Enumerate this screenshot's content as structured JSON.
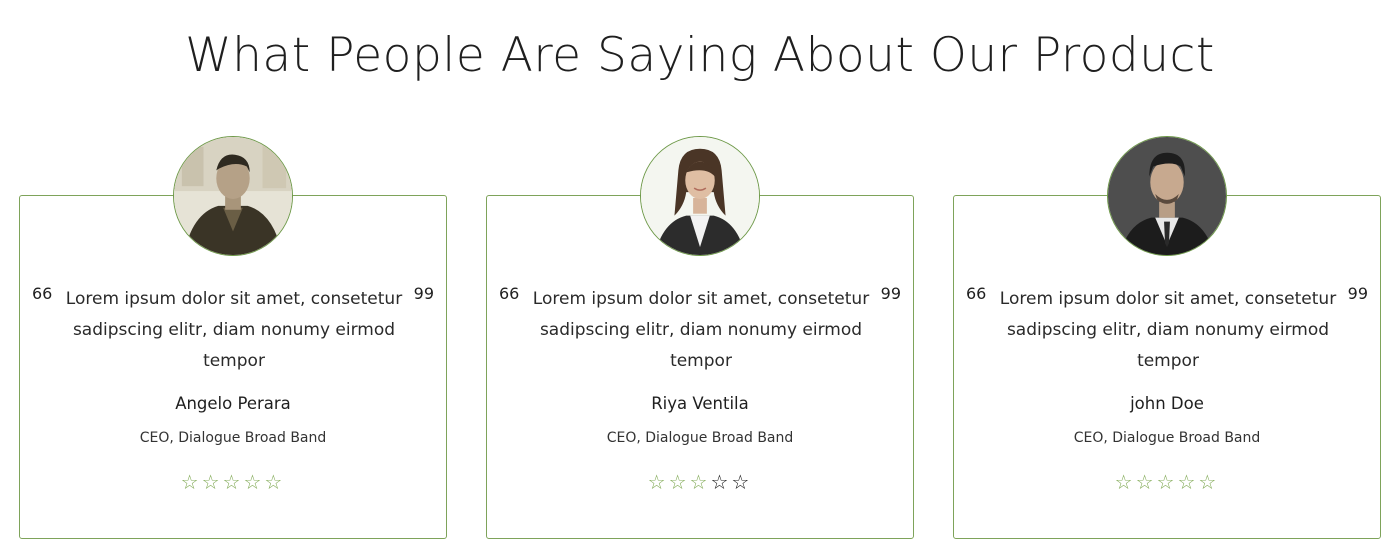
{
  "page": {
    "title": "What People Are Saying About Our Product"
  },
  "colors": {
    "accent_green": "#7ea35a",
    "text": "#222222",
    "background": "#ffffff"
  },
  "quote_marks": {
    "open": "66",
    "close": "99"
  },
  "testimonials": [
    {
      "quote": "Lorem ipsum dolor sit amet, consetetur sadipscing elitr, diam nonumy eirmod tempor",
      "name": "Angelo Perara",
      "role": "CEO, Dialogue Broad Band",
      "rating_stars": 5,
      "rating_filled": 5
    },
    {
      "quote": "Lorem ipsum dolor sit amet, consetetur sadipscing elitr, diam nonumy eirmod tempor",
      "name": "Riya Ventila",
      "role": "CEO, Dialogue Broad Band",
      "rating_stars": 5,
      "rating_filled": 3
    },
    {
      "quote": "Lorem ipsum dolor sit amet, consetetur sadipscing elitr, diam nonumy eirmod tempor",
      "name": "john Doe",
      "role": "CEO, Dialogue Broad Band",
      "rating_stars": 5,
      "rating_filled": 5
    }
  ]
}
